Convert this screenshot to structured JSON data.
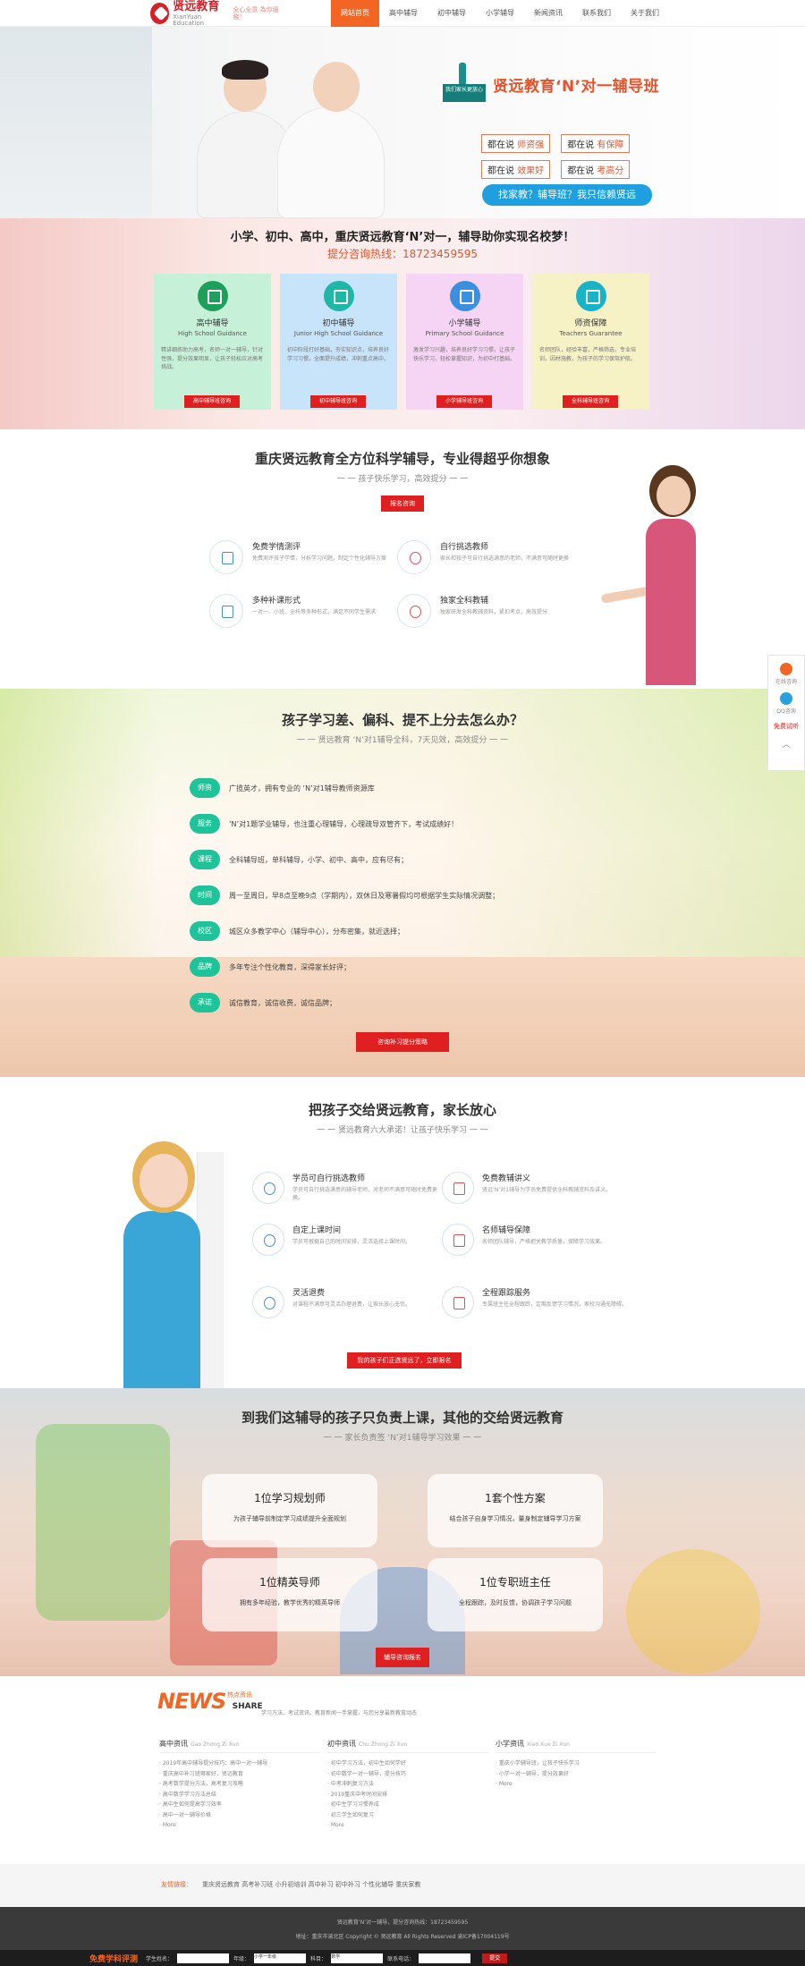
{
  "nav": {
    "logo_cn": "贤远教育",
    "logo_en": "XianYuan Education",
    "logo_slogan": "全心全意 為你服務！",
    "items": [
      "网站首页",
      "高中辅导",
      "初中辅导",
      "小学辅导",
      "新闻资讯",
      "联系我们",
      "关于我们"
    ]
  },
  "hero": {
    "badge": "我们家长更放心",
    "title": "贤远教育‘N’对一辅导班",
    "tags": [
      {
        "prefix": "都在说",
        "word": "师资强"
      },
      {
        "prefix": "都在说",
        "word": "有保障"
      },
      {
        "prefix": "都在说",
        "word": "效果好"
      },
      {
        "prefix": "都在说",
        "word": "考高分"
      }
    ],
    "button": "找家教？辅导班？我只信赖贤远"
  },
  "section2": {
    "title": "小学、初中、高中，重庆贤远教育‘N’对一，辅导助你实现名校梦！",
    "hotline": "提分咨询热线：18723459595",
    "cards": [
      {
        "title": "高中辅导",
        "subtitle": "High School Guidance",
        "desc": "精讲细练助力高考，名师一对一辅导，针对性强，提分效果明显，让孩子轻松应对高考挑战。",
        "button": "高中辅导班咨询"
      },
      {
        "title": "初中辅导",
        "subtitle": "Junior High School Guidance",
        "desc": "初中阶段打好基础，夯实知识点，培养良好学习习惯，全面提升成绩，冲刺重点高中。",
        "button": "初中辅导班咨询"
      },
      {
        "title": "小学辅导",
        "subtitle": "Primary School Guidance",
        "desc": "激发学习兴趣，培养良好学习习惯，让孩子快乐学习，轻松掌握知识，为初中打基础。",
        "button": "小学辅导班咨询"
      },
      {
        "title": "师资保障",
        "subtitle": "Teachers Guarantee",
        "desc": "名师团队，经验丰富，严格筛选，专业培训，因材施教，为孩子的学习保驾护航。",
        "button": "全科辅导班咨询"
      }
    ]
  },
  "section3": {
    "title": "重庆贤远教育全方位科学辅导，专业得超乎你想象",
    "subtitle": "一 一 孩子快乐学习，高效提分 一 一",
    "button": "报名咨询",
    "features": [
      {
        "title": "免费学情测评",
        "desc": "免费测评孩子学情，分析学习问题，制定个性化辅导方案"
      },
      {
        "title": "自行挑选教师",
        "desc": "家长和孩子可自行挑选满意的老师，不满意可随时更换"
      },
      {
        "title": "多种补课形式",
        "desc": "一对一、小班、全托等多种形式，满足不同学生需求"
      },
      {
        "title": "独家全科教辅",
        "desc": "独家研发全科教辅资料，紧扣考点，高效提分"
      }
    ]
  },
  "section4": {
    "title": "孩子学习差、偏科、提不上分去怎么办？",
    "subtitle": "一 一 贤远教育 ‘N’对1辅导全科，7天见效，高效提分 一 一",
    "rows": [
      {
        "tag": "师资",
        "text": "广揽英才，拥有专业的 ‘N’对1辅导教师资源库"
      },
      {
        "tag": "服务",
        "text": "‘N’对1题学业辅导，也注重心理辅导，心理疏导双管齐下，考试成绩好！"
      },
      {
        "tag": "课程",
        "text": "全科辅导班，单科辅导，小学、初中、高中，应有尽有；"
      },
      {
        "tag": "时间",
        "text": "周一至周日，早8点至晚9点（学期内），双休日及寒暑假均可根据学生实际情况调整；"
      },
      {
        "tag": "校区",
        "text": "城区众多教学中心（辅导中心），分布密集，就近选择；"
      },
      {
        "tag": "品牌",
        "text": "多年专注个性化教育，深得家长好评；"
      },
      {
        "tag": "承诺",
        "text": "诚信教育，诚信收费，诚信品牌；"
      }
    ],
    "button": "咨询补习提分策略"
  },
  "section5": {
    "title": "把孩子交给贤远教育，家长放心",
    "subtitle": "一 一 贤远教育六大承诺！让孩子快乐学习 一 一",
    "features": [
      {
        "title": "学员可自行挑选教师",
        "desc": "学员可自行挑选满意的辅导老师，对老师不满意可随时免费更换。"
      },
      {
        "title": "免费教辅讲义",
        "desc": "贤远‘N’对1辅导为学员免费提供全科教辅资料及讲义。"
      },
      {
        "title": "自定上课时间",
        "desc": "学员可根据自己的时间安排，灵活选择上课时间。"
      },
      {
        "title": "名师辅导保障",
        "desc": "名师团队辅导，严格把关教学质量，保障学习效果。"
      },
      {
        "title": "灵活退费",
        "desc": "对课程不满意可灵活办理退费，让家长放心无忧。"
      },
      {
        "title": "全程跟踪服务",
        "desc": "专属班主任全程跟踪，定期反馈学习情况，家校沟通无障碍。"
      }
    ],
    "button": "我的孩子们正选贤远了，立即报名"
  },
  "section6": {
    "title": "到我们这辅导的孩子只负责上课，其他的交给贤远教育",
    "subtitle": "一 一 家长负责签 ‘N’对1辅导学习效果 一 一",
    "boxes": [
      {
        "title": "1位学习规划师",
        "desc": "为孩子辅导前制定学习成绩提升全面规划"
      },
      {
        "title": "1套个性方案",
        "desc": "结合孩子自身学习情况，量身制定辅导学习方案"
      },
      {
        "title": "1位精英导师",
        "desc": "拥有多年经验，教学优秀的精英导师"
      },
      {
        "title": "1位专职班主任",
        "desc": "全程跟踪，及时反馈，协调孩子学习问题"
      }
    ],
    "button": "辅导咨询报名"
  },
  "news": {
    "logo": "NEWS",
    "logo_small": "SHARE",
    "cn": "热点资讯",
    "desc": "学习方法、考试资讯、教育新闻一手掌握，与您分享最新教育动态",
    "columns": [
      {
        "head": "高中资讯",
        "en": "Gao Zhong Zi Xun",
        "items": [
          "2019年高中辅导提分技巧：高中一对一辅导",
          "重庆高中补习班哪家好，贤远教育",
          "高考数学提分方法，高考复习攻略",
          "高中数学学习方法总结",
          "高中生如何提高学习效率",
          "高中一对一辅导价格",
          "More"
        ]
      },
      {
        "head": "初中资讯",
        "en": "Chu Zhong Zi Xun",
        "items": [
          "初中学习方法，初中生如何学好",
          "初中数学一对一辅导，提分技巧",
          "中考冲刺复习方法",
          "2019重庆中考时间安排",
          "初中生学习习惯养成",
          "初三学生如何复习",
          "More"
        ]
      },
      {
        "head": "小学资讯",
        "en": "Xiao Xue Zi Xun",
        "items": [
          "重庆小学辅导班，让孩子快乐学习",
          "小学一对一辅导，提分效果好",
          "More"
        ]
      }
    ]
  },
  "links": {
    "label": "友情链接：",
    "text": "重庆贤远教育 高考补习班 小升初培训 高中补习 初中补习 个性化辅导 重庆家教"
  },
  "footer": {
    "line1": "贤远教育‘N’对一辅导，提分咨询热线：18723459595",
    "line2": "地址：重庆市渝北区 Copyright © 贤远教育 All Rights Reserved 渝ICP备17004119号",
    "bar_title": "免费学科评测",
    "bar_fields": [
      "学生姓名：",
      "年级：",
      "科目：",
      "联系电话："
    ],
    "select_grade": "小学一年级",
    "select_subject": "数学",
    "submit": "提交"
  },
  "float": {
    "item1": "在线咨询",
    "item2": "QQ咨询",
    "item3": "免费试听",
    "up": "︿"
  }
}
